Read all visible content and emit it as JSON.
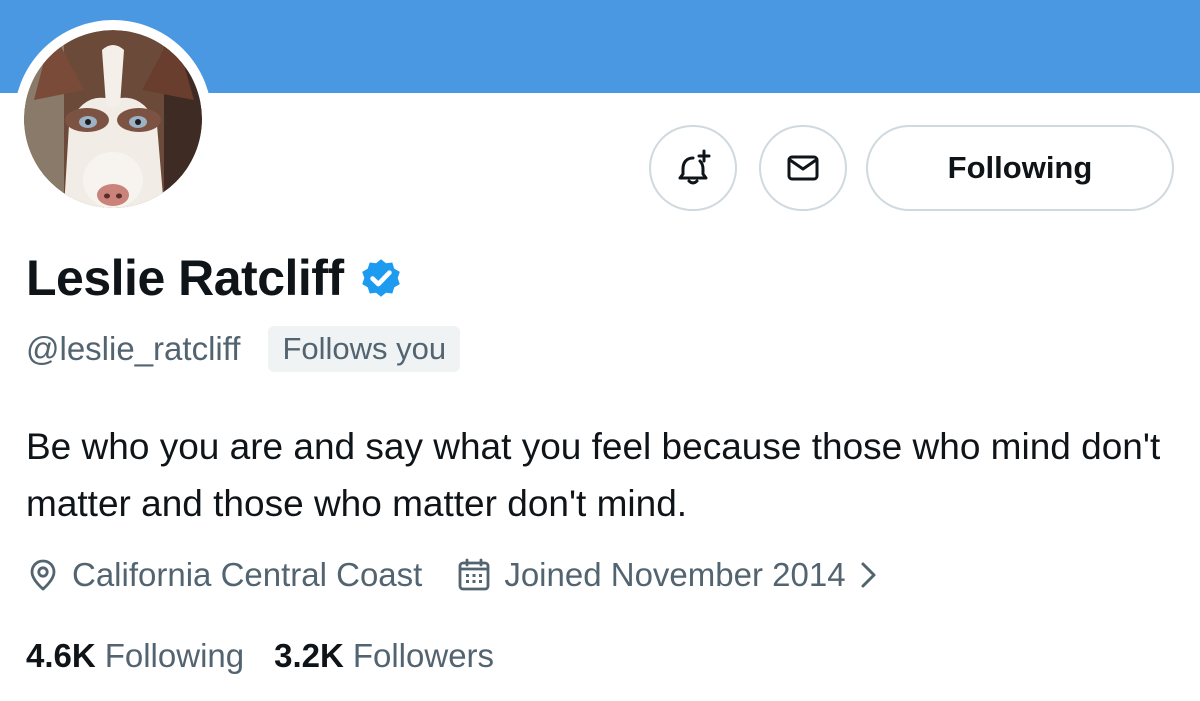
{
  "profile": {
    "display_name": "Leslie Ratcliff",
    "verified": true,
    "handle": "@leslie_ratcliff",
    "follows_you_label": "Follows you",
    "bio": "Be who you are and say what you feel because those who mind don't matter and those who matter don't mind.",
    "location": "California Central Coast",
    "joined": "Joined November 2014",
    "following_count": "4.6K",
    "following_label": "Following",
    "followers_count": "3.2K",
    "followers_label": "Followers"
  },
  "actions": {
    "notify_icon": "bell-plus-icon",
    "message_icon": "envelope-icon",
    "following_button_label": "Following"
  },
  "colors": {
    "banner": "#4a97e2",
    "verified_badge": "#1d9bf0",
    "secondary_text": "#536471",
    "primary_text": "#0f1419"
  }
}
